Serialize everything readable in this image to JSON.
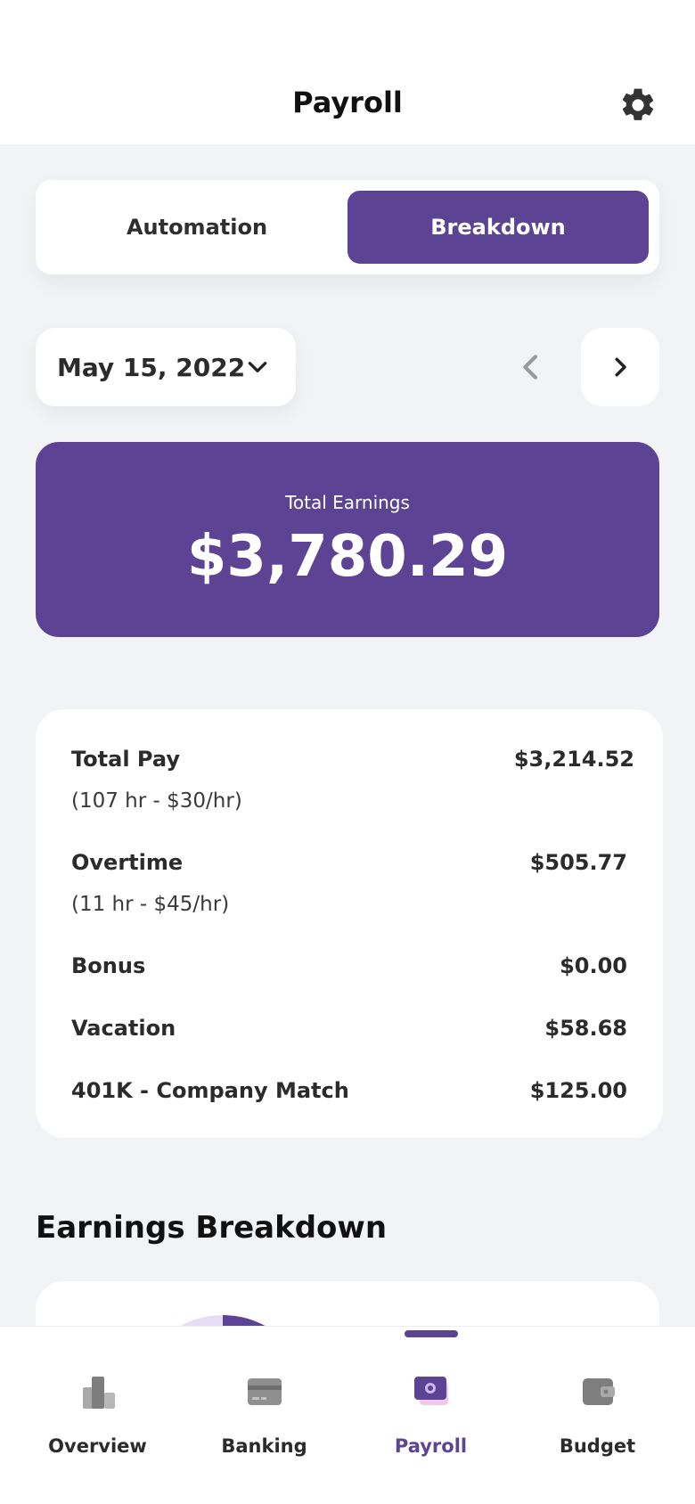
{
  "header": {
    "title": "Payroll",
    "settings_icon": "gear-icon"
  },
  "segment": {
    "options": [
      "Automation",
      "Breakdown"
    ],
    "selected": "Breakdown"
  },
  "date_selector": {
    "value": "May 15, 2022"
  },
  "earnings": {
    "label": "Total Earnings",
    "value": "$3,780.29"
  },
  "pay_items": [
    {
      "label": "Total Pay",
      "detail": "(107 hr - $30/hr)",
      "amount": "$3,214.52"
    },
    {
      "label": "Overtime",
      "detail": "(11 hr - $45/hr)",
      "amount": "$505.77"
    },
    {
      "label": "Bonus",
      "amount": "$0.00"
    },
    {
      "label": "Vacation",
      "amount": "$58.68"
    },
    {
      "label": "401K - Company Match",
      "amount": "$125.00"
    }
  ],
  "section": {
    "earnings_breakdown": "Earnings Breakdown"
  },
  "tabs": [
    {
      "label": "Overview",
      "icon": "overview-icon"
    },
    {
      "label": "Banking",
      "icon": "bank-card-icon"
    },
    {
      "label": "Payroll",
      "icon": "payroll-icon",
      "active": true
    },
    {
      "label": "Budget",
      "icon": "wallet-icon"
    }
  ],
  "colors": {
    "accent": "#5d4393",
    "background": "#f2f3f5",
    "card": "#ffffff",
    "inactive_icon": "#8a8a8a"
  }
}
